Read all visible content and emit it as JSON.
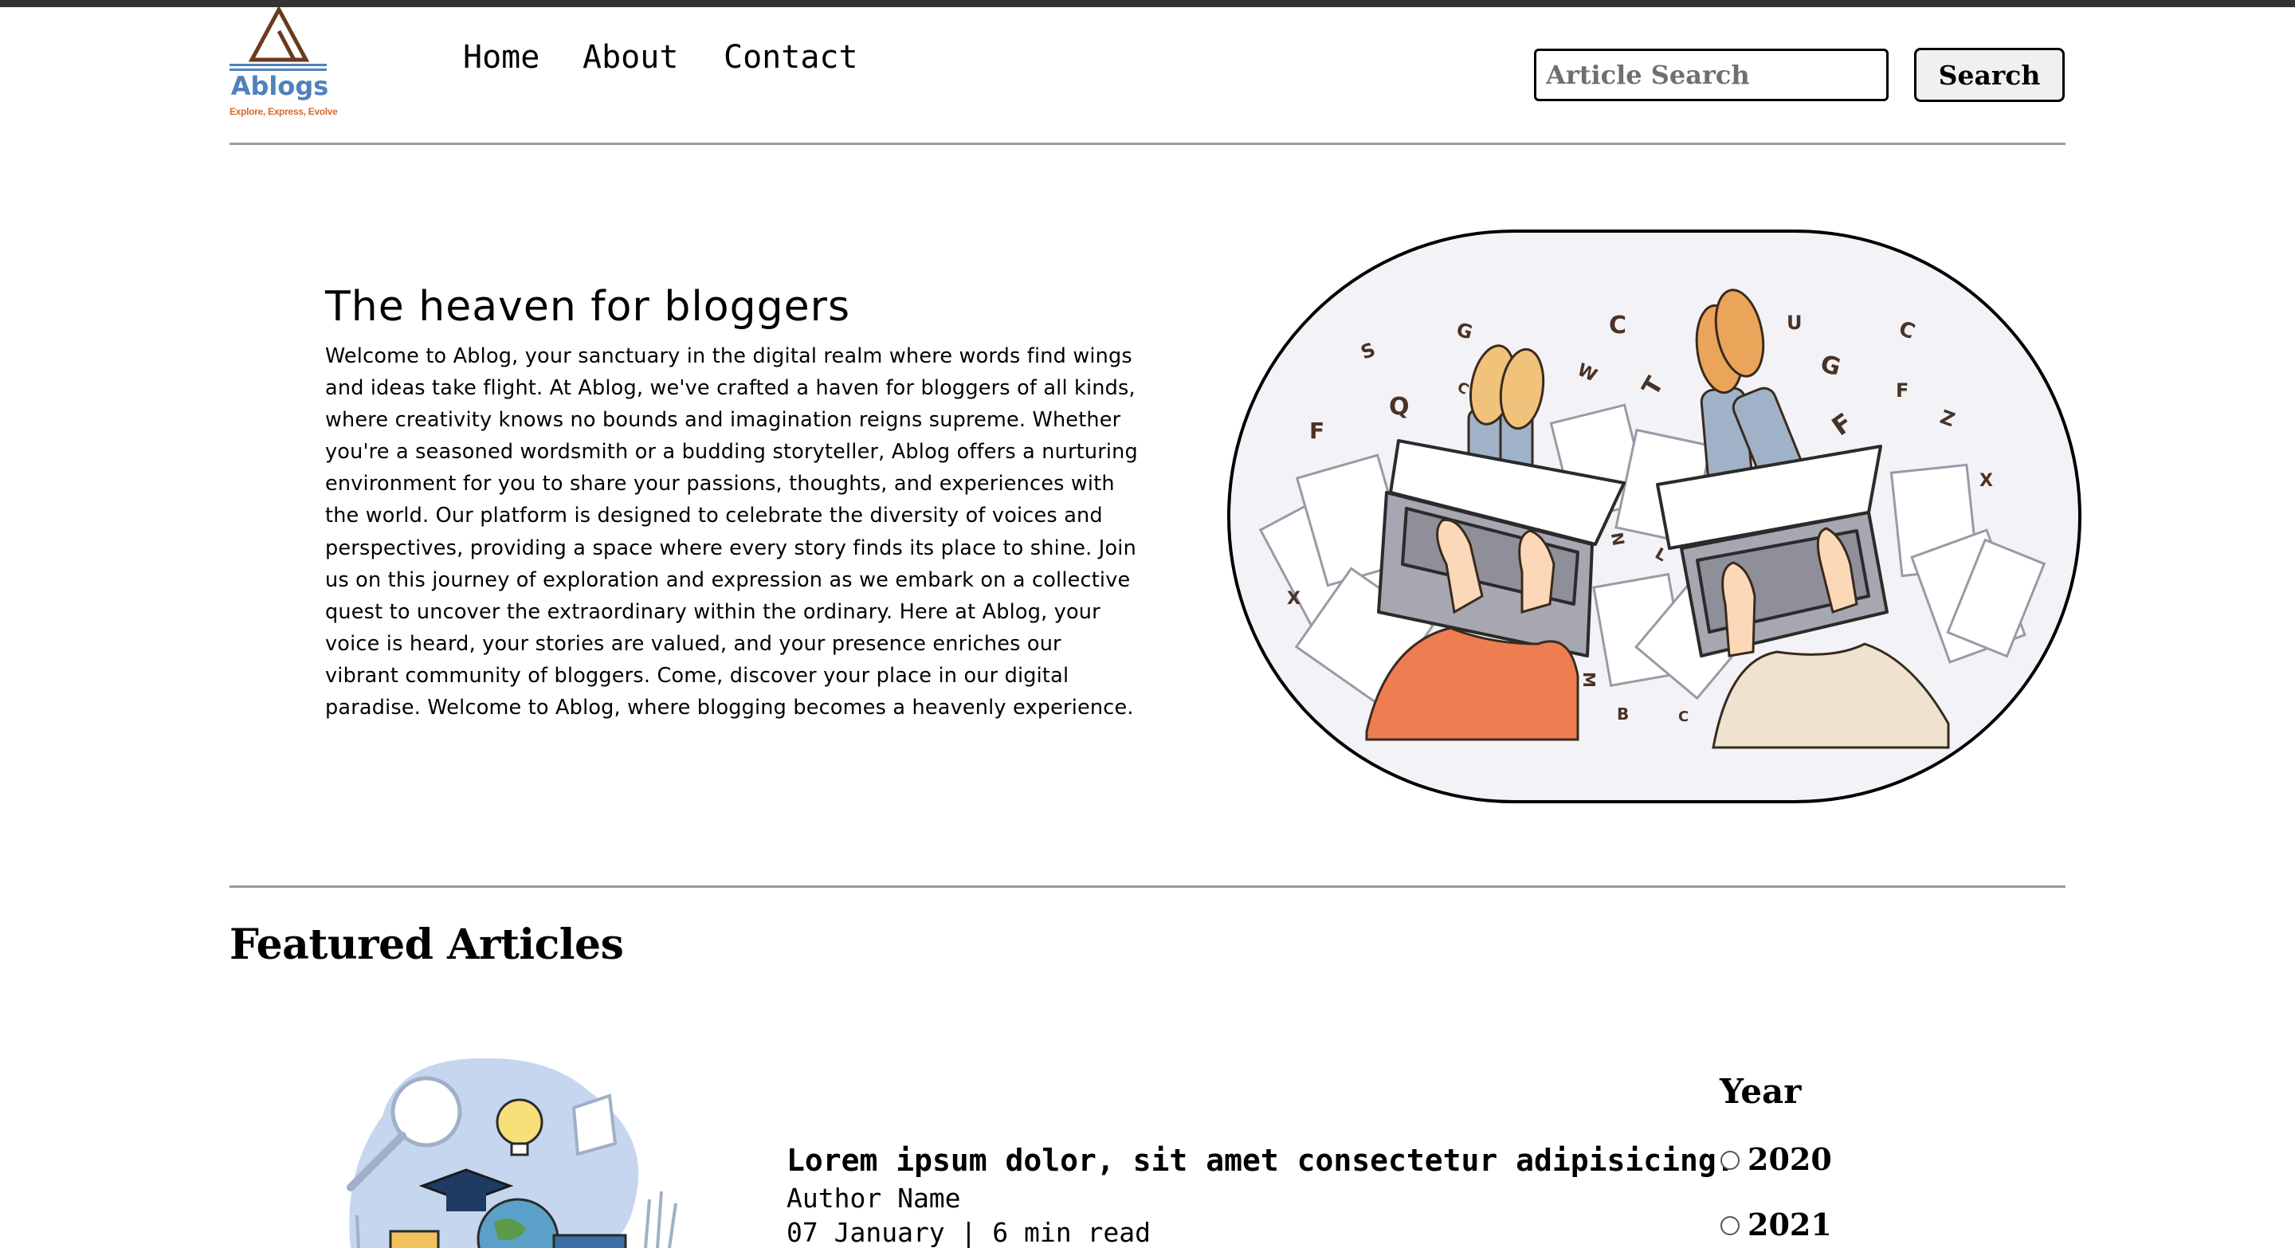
{
  "brand": {
    "name": "Ablogs",
    "tagline": "Explore, Express, Evolve",
    "colors": {
      "primary": "#4f81bd",
      "accent": "#d86a2a",
      "logo_mark": "#6b3a1e"
    }
  },
  "nav": {
    "items": [
      {
        "label": "Home"
      },
      {
        "label": "About"
      },
      {
        "label": "Contact"
      }
    ]
  },
  "search": {
    "placeholder": "Article Search",
    "value": "",
    "button_label": "Search"
  },
  "hero": {
    "title": "The heaven for bloggers",
    "body": "Welcome to Ablog, your sanctuary in the digital realm where words find wings and ideas take flight. At Ablog, we've crafted a haven for bloggers of all kinds, where creativity knows no bounds and imagination reigns supreme. Whether you're a seasoned wordsmith or a budding storyteller, Ablog offers a nurturing environment for you to share your passions, thoughts, and experiences with the world. Our platform is designed to celebrate the diversity of voices and perspectives, providing a space where every story finds its place to shine. Join us on this journey of exploration and expression as we embark on a collective quest to uncover the extraordinary within the ordinary. Here at Ablog, your voice is heard, your stories are valued, and your presence enriches our vibrant community of bloggers. Come, discover your place in our digital paradise. Welcome to Ablog, where blogging becomes a heavenly experience.",
    "illustration_letters": [
      "S",
      "G",
      "C",
      "U",
      "C",
      "Q",
      "C",
      "W",
      "T",
      "G",
      "F",
      "F",
      "Z",
      "X",
      "N",
      "L",
      "X",
      "M",
      "B",
      "C",
      "F"
    ]
  },
  "featured": {
    "title": "Featured Articles",
    "articles": [
      {
        "title": "Lorem ipsum dolor, sit amet consectetur adipisicing.",
        "author": "Author Name",
        "meta": "07 January | 6 min read"
      }
    ]
  },
  "filter": {
    "title": "Year",
    "options": [
      {
        "label": "2020",
        "checked": false
      },
      {
        "label": "2021",
        "checked": false
      }
    ]
  }
}
